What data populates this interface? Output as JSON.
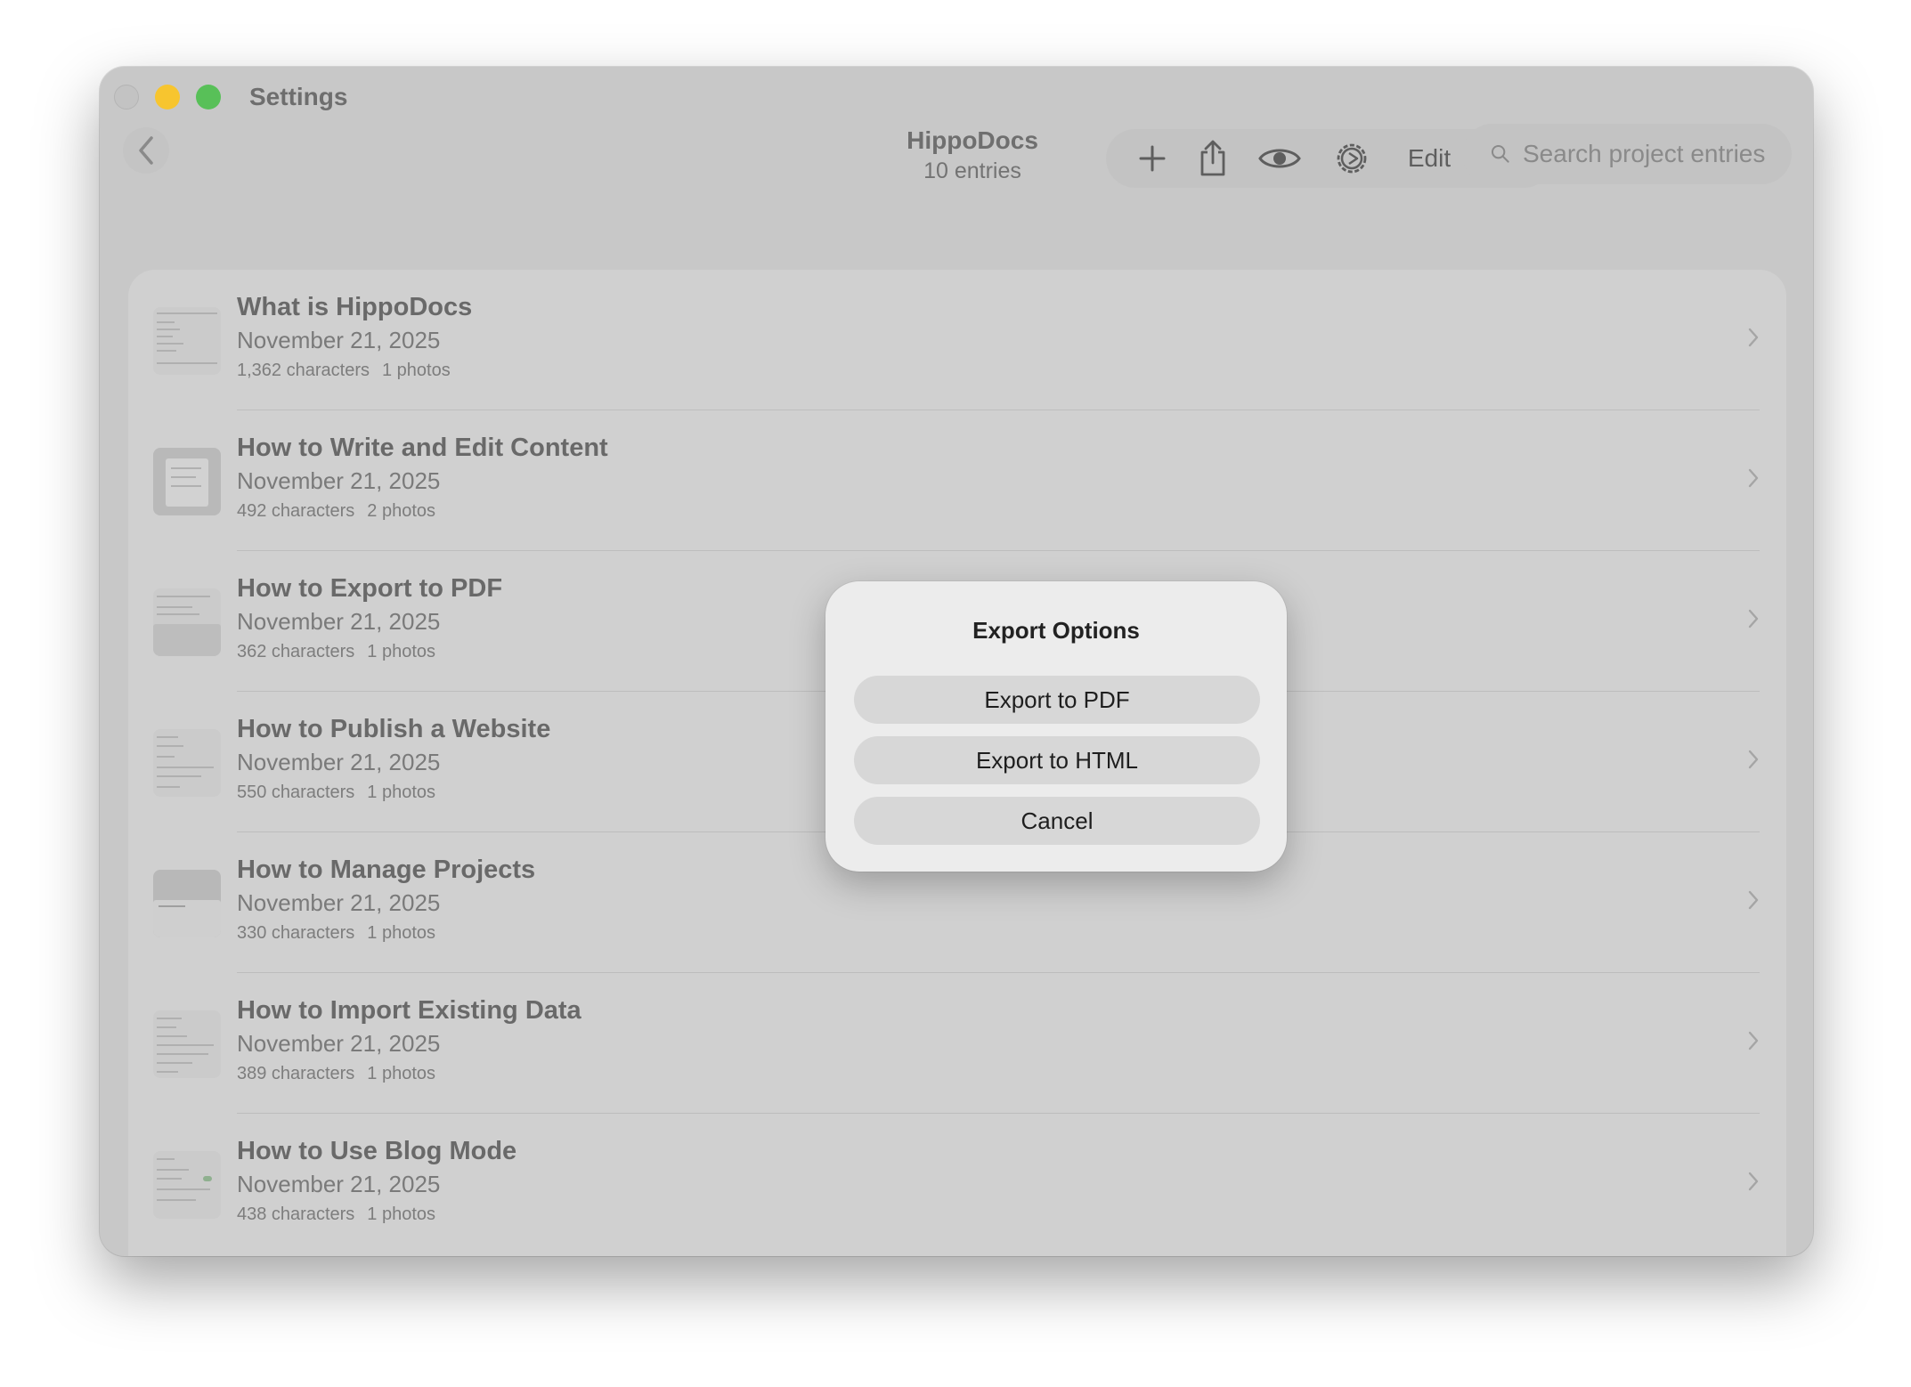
{
  "window": {
    "title": "Settings"
  },
  "header": {
    "project_name": "HippoDocs",
    "entry_count": "10 entries",
    "edit_label": "Edit",
    "search_placeholder": "Search project entries"
  },
  "entries": [
    {
      "title": "What is HippoDocs",
      "date": "November 21, 2025",
      "characters": "1,362 characters",
      "photos": "1 photos"
    },
    {
      "title": "How to Write and Edit Content",
      "date": "November 21, 2025",
      "characters": "492 characters",
      "photos": "2 photos"
    },
    {
      "title": "How to Export to PDF",
      "date": "November 21, 2025",
      "characters": "362 characters",
      "photos": "1 photos"
    },
    {
      "title": "How to Publish a Website",
      "date": "November 21, 2025",
      "characters": "550 characters",
      "photos": "1 photos"
    },
    {
      "title": "How to Manage Projects",
      "date": "November 21, 2025",
      "characters": "330 characters",
      "photos": "1 photos"
    },
    {
      "title": "How to Import Existing Data",
      "date": "November 21, 2025",
      "characters": "389 characters",
      "photos": "1 photos"
    },
    {
      "title": "How to Use Blog Mode",
      "date": "November 21, 2025",
      "characters": "438 characters",
      "photos": "1 photos"
    }
  ],
  "dialog": {
    "title": "Export Options",
    "buttons": {
      "pdf": "Export to PDF",
      "html": "Export to HTML",
      "cancel": "Cancel"
    }
  }
}
